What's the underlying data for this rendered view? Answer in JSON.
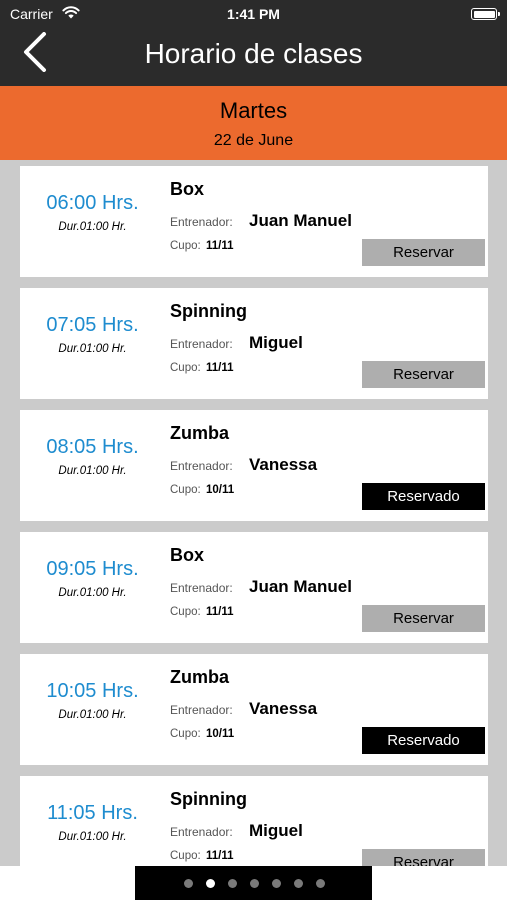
{
  "status_bar": {
    "carrier": "Carrier",
    "time": "1:41 PM"
  },
  "nav": {
    "title": "Horario de clases"
  },
  "day": {
    "name": "Martes",
    "date": "22 de June"
  },
  "labels": {
    "trainer": "Entrenador:",
    "capacity": "Cupo:"
  },
  "classes": [
    {
      "time": "06:00 Hrs.",
      "duration": "Dur.01:00 Hr.",
      "name": "Box",
      "trainer": "Juan Manuel",
      "capacity": "11/11",
      "action": "Reservar",
      "reserved": false
    },
    {
      "time": "07:05 Hrs.",
      "duration": "Dur.01:00 Hr.",
      "name": "Spinning",
      "trainer": "Miguel",
      "capacity": "11/11",
      "action": "Reservar",
      "reserved": false
    },
    {
      "time": "08:05 Hrs.",
      "duration": "Dur.01:00 Hr.",
      "name": "Zumba",
      "trainer": "Vanessa",
      "capacity": "10/11",
      "action": "Reservado",
      "reserved": true
    },
    {
      "time": "09:05 Hrs.",
      "duration": "Dur.01:00 Hr.",
      "name": "Box",
      "trainer": "Juan Manuel",
      "capacity": "11/11",
      "action": "Reservar",
      "reserved": false
    },
    {
      "time": "10:05 Hrs.",
      "duration": "Dur.01:00 Hr.",
      "name": "Zumba",
      "trainer": "Vanessa",
      "capacity": "10/11",
      "action": "Reservado",
      "reserved": true
    },
    {
      "time": "11:05 Hrs.",
      "duration": "Dur.01:00 Hr.",
      "name": "Spinning",
      "trainer": "Miguel",
      "capacity": "11/11",
      "action": "Reservar",
      "reserved": false
    }
  ],
  "pager": {
    "pages": 7,
    "current": 2
  }
}
